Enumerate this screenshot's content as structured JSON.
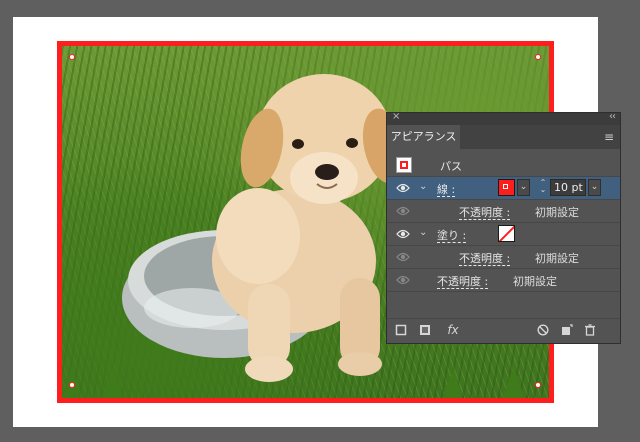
{
  "panel": {
    "title": "アピアランス",
    "close_glyph": "×",
    "collapse_glyph": "‹‹",
    "menu_glyph": "≡"
  },
  "rows": {
    "object_label": "パス",
    "stroke_label": "線 :",
    "stroke_weight": "10 pt",
    "stroke_opacity_label": "不透明度 :",
    "stroke_opacity_value": "初期設定",
    "fill_label": "塗り :",
    "fill_opacity_label": "不透明度 :",
    "fill_opacity_value": "初期設定",
    "object_opacity_label": "不透明度 :",
    "object_opacity_value": "初期設定"
  },
  "bottom_bar": {
    "fx_label": "fx"
  },
  "colors": {
    "stroke": "#ff1e1e",
    "fill": "none",
    "selection_row": "#41607f",
    "panel_bg": "#535353",
    "workspace_bg": "#5f5f5f"
  },
  "icons": [
    "eye-icon",
    "square-icon",
    "filled-square-icon",
    "fx-icon",
    "clear-appearance-icon",
    "duplicate-item-icon",
    "trash-icon"
  ]
}
